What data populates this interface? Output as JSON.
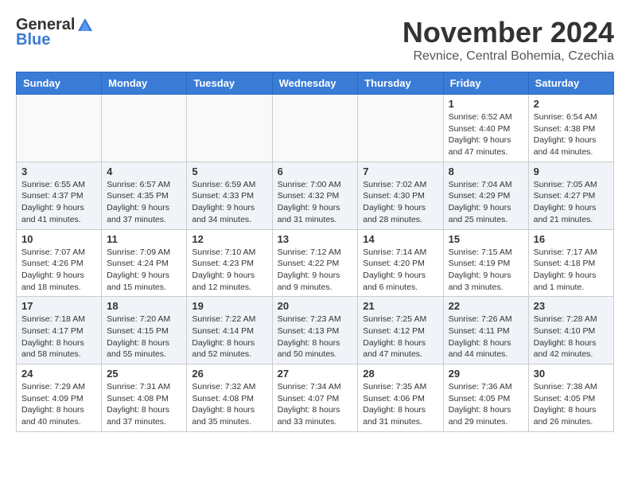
{
  "logo": {
    "general": "General",
    "blue": "Blue"
  },
  "title": "November 2024",
  "subtitle": "Revnice, Central Bohemia, Czechia",
  "headers": [
    "Sunday",
    "Monday",
    "Tuesday",
    "Wednesday",
    "Thursday",
    "Friday",
    "Saturday"
  ],
  "weeks": [
    {
      "shaded": false,
      "days": [
        {
          "date": "",
          "info": ""
        },
        {
          "date": "",
          "info": ""
        },
        {
          "date": "",
          "info": ""
        },
        {
          "date": "",
          "info": ""
        },
        {
          "date": "",
          "info": ""
        },
        {
          "date": "1",
          "info": "Sunrise: 6:52 AM\nSunset: 4:40 PM\nDaylight: 9 hours\nand 47 minutes."
        },
        {
          "date": "2",
          "info": "Sunrise: 6:54 AM\nSunset: 4:38 PM\nDaylight: 9 hours\nand 44 minutes."
        }
      ]
    },
    {
      "shaded": true,
      "days": [
        {
          "date": "3",
          "info": "Sunrise: 6:55 AM\nSunset: 4:37 PM\nDaylight: 9 hours\nand 41 minutes."
        },
        {
          "date": "4",
          "info": "Sunrise: 6:57 AM\nSunset: 4:35 PM\nDaylight: 9 hours\nand 37 minutes."
        },
        {
          "date": "5",
          "info": "Sunrise: 6:59 AM\nSunset: 4:33 PM\nDaylight: 9 hours\nand 34 minutes."
        },
        {
          "date": "6",
          "info": "Sunrise: 7:00 AM\nSunset: 4:32 PM\nDaylight: 9 hours\nand 31 minutes."
        },
        {
          "date": "7",
          "info": "Sunrise: 7:02 AM\nSunset: 4:30 PM\nDaylight: 9 hours\nand 28 minutes."
        },
        {
          "date": "8",
          "info": "Sunrise: 7:04 AM\nSunset: 4:29 PM\nDaylight: 9 hours\nand 25 minutes."
        },
        {
          "date": "9",
          "info": "Sunrise: 7:05 AM\nSunset: 4:27 PM\nDaylight: 9 hours\nand 21 minutes."
        }
      ]
    },
    {
      "shaded": false,
      "days": [
        {
          "date": "10",
          "info": "Sunrise: 7:07 AM\nSunset: 4:26 PM\nDaylight: 9 hours\nand 18 minutes."
        },
        {
          "date": "11",
          "info": "Sunrise: 7:09 AM\nSunset: 4:24 PM\nDaylight: 9 hours\nand 15 minutes."
        },
        {
          "date": "12",
          "info": "Sunrise: 7:10 AM\nSunset: 4:23 PM\nDaylight: 9 hours\nand 12 minutes."
        },
        {
          "date": "13",
          "info": "Sunrise: 7:12 AM\nSunset: 4:22 PM\nDaylight: 9 hours\nand 9 minutes."
        },
        {
          "date": "14",
          "info": "Sunrise: 7:14 AM\nSunset: 4:20 PM\nDaylight: 9 hours\nand 6 minutes."
        },
        {
          "date": "15",
          "info": "Sunrise: 7:15 AM\nSunset: 4:19 PM\nDaylight: 9 hours\nand 3 minutes."
        },
        {
          "date": "16",
          "info": "Sunrise: 7:17 AM\nSunset: 4:18 PM\nDaylight: 9 hours\nand 1 minute."
        }
      ]
    },
    {
      "shaded": true,
      "days": [
        {
          "date": "17",
          "info": "Sunrise: 7:18 AM\nSunset: 4:17 PM\nDaylight: 8 hours\nand 58 minutes."
        },
        {
          "date": "18",
          "info": "Sunrise: 7:20 AM\nSunset: 4:15 PM\nDaylight: 8 hours\nand 55 minutes."
        },
        {
          "date": "19",
          "info": "Sunrise: 7:22 AM\nSunset: 4:14 PM\nDaylight: 8 hours\nand 52 minutes."
        },
        {
          "date": "20",
          "info": "Sunrise: 7:23 AM\nSunset: 4:13 PM\nDaylight: 8 hours\nand 50 minutes."
        },
        {
          "date": "21",
          "info": "Sunrise: 7:25 AM\nSunset: 4:12 PM\nDaylight: 8 hours\nand 47 minutes."
        },
        {
          "date": "22",
          "info": "Sunrise: 7:26 AM\nSunset: 4:11 PM\nDaylight: 8 hours\nand 44 minutes."
        },
        {
          "date": "23",
          "info": "Sunrise: 7:28 AM\nSunset: 4:10 PM\nDaylight: 8 hours\nand 42 minutes."
        }
      ]
    },
    {
      "shaded": false,
      "days": [
        {
          "date": "24",
          "info": "Sunrise: 7:29 AM\nSunset: 4:09 PM\nDaylight: 8 hours\nand 40 minutes."
        },
        {
          "date": "25",
          "info": "Sunrise: 7:31 AM\nSunset: 4:08 PM\nDaylight: 8 hours\nand 37 minutes."
        },
        {
          "date": "26",
          "info": "Sunrise: 7:32 AM\nSunset: 4:08 PM\nDaylight: 8 hours\nand 35 minutes."
        },
        {
          "date": "27",
          "info": "Sunrise: 7:34 AM\nSunset: 4:07 PM\nDaylight: 8 hours\nand 33 minutes."
        },
        {
          "date": "28",
          "info": "Sunrise: 7:35 AM\nSunset: 4:06 PM\nDaylight: 8 hours\nand 31 minutes."
        },
        {
          "date": "29",
          "info": "Sunrise: 7:36 AM\nSunset: 4:05 PM\nDaylight: 8 hours\nand 29 minutes."
        },
        {
          "date": "30",
          "info": "Sunrise: 7:38 AM\nSunset: 4:05 PM\nDaylight: 8 hours\nand 26 minutes."
        }
      ]
    }
  ]
}
